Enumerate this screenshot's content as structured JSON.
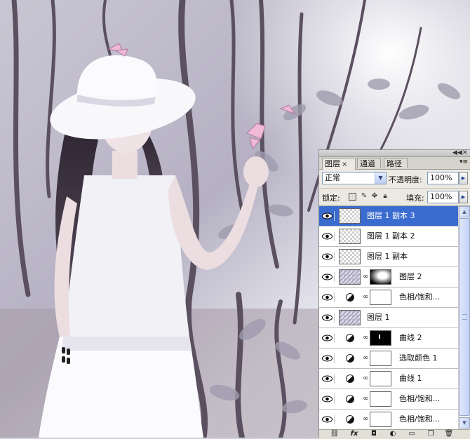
{
  "panel": {
    "tabs": [
      {
        "label": "图层",
        "active": true
      },
      {
        "label": "通道",
        "active": false
      },
      {
        "label": "路径",
        "active": false
      }
    ],
    "tab_close": "×",
    "collapse_label": "◀◀",
    "close_label": "✕",
    "menu_label": "▾≡",
    "blend_mode": "正常",
    "opacity_label": "不透明度:",
    "opacity_value": "100%",
    "lock_label": "锁定:",
    "fill_label": "填充:",
    "fill_value": "100%",
    "layers": [
      {
        "name": "图层 1 副本 3",
        "kind": "pixel",
        "selected": true
      },
      {
        "name": "图层 1 副本 2",
        "kind": "pixel",
        "selected": false
      },
      {
        "name": "图层 1 副本",
        "kind": "pixel",
        "selected": false
      },
      {
        "name": "图层 2",
        "kind": "pixel-mask",
        "selected": false
      },
      {
        "name": "色相/饱和...",
        "kind": "adjustment",
        "selected": false
      },
      {
        "name": "图层 1",
        "kind": "photo",
        "selected": false
      },
      {
        "name": "曲线 2",
        "kind": "adjustment-black",
        "selected": false
      },
      {
        "name": "选取颜色 1",
        "kind": "adjustment",
        "selected": false
      },
      {
        "name": "曲线 1",
        "kind": "adjustment",
        "selected": false
      },
      {
        "name": "色相/饱和...",
        "kind": "adjustment",
        "selected": false
      },
      {
        "name": "色相/饱和...",
        "kind": "adjustment",
        "selected": false
      }
    ],
    "bottom_icons": [
      "link-icon",
      "fx-icon",
      "mask-icon",
      "adjustment-icon",
      "group-icon",
      "new-layer-icon",
      "trash-icon"
    ],
    "fx_label": "fx"
  },
  "colors": {
    "selection": "#3a6ccf",
    "panel_bg": "#ece9e2"
  }
}
